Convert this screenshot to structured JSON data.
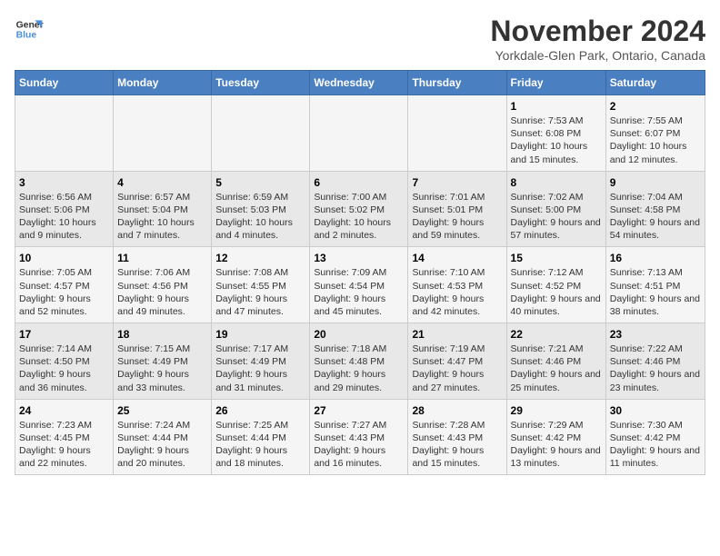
{
  "logo": {
    "line1": "General",
    "line2": "Blue"
  },
  "title": "November 2024",
  "location": "Yorkdale-Glen Park, Ontario, Canada",
  "headers": [
    "Sunday",
    "Monday",
    "Tuesday",
    "Wednesday",
    "Thursday",
    "Friday",
    "Saturday"
  ],
  "weeks": [
    [
      {
        "day": "",
        "info": ""
      },
      {
        "day": "",
        "info": ""
      },
      {
        "day": "",
        "info": ""
      },
      {
        "day": "",
        "info": ""
      },
      {
        "day": "",
        "info": ""
      },
      {
        "day": "1",
        "info": "Sunrise: 7:53 AM\nSunset: 6:08 PM\nDaylight: 10 hours and 15 minutes."
      },
      {
        "day": "2",
        "info": "Sunrise: 7:55 AM\nSunset: 6:07 PM\nDaylight: 10 hours and 12 minutes."
      }
    ],
    [
      {
        "day": "3",
        "info": "Sunrise: 6:56 AM\nSunset: 5:06 PM\nDaylight: 10 hours and 9 minutes."
      },
      {
        "day": "4",
        "info": "Sunrise: 6:57 AM\nSunset: 5:04 PM\nDaylight: 10 hours and 7 minutes."
      },
      {
        "day": "5",
        "info": "Sunrise: 6:59 AM\nSunset: 5:03 PM\nDaylight: 10 hours and 4 minutes."
      },
      {
        "day": "6",
        "info": "Sunrise: 7:00 AM\nSunset: 5:02 PM\nDaylight: 10 hours and 2 minutes."
      },
      {
        "day": "7",
        "info": "Sunrise: 7:01 AM\nSunset: 5:01 PM\nDaylight: 9 hours and 59 minutes."
      },
      {
        "day": "8",
        "info": "Sunrise: 7:02 AM\nSunset: 5:00 PM\nDaylight: 9 hours and 57 minutes."
      },
      {
        "day": "9",
        "info": "Sunrise: 7:04 AM\nSunset: 4:58 PM\nDaylight: 9 hours and 54 minutes."
      }
    ],
    [
      {
        "day": "10",
        "info": "Sunrise: 7:05 AM\nSunset: 4:57 PM\nDaylight: 9 hours and 52 minutes."
      },
      {
        "day": "11",
        "info": "Sunrise: 7:06 AM\nSunset: 4:56 PM\nDaylight: 9 hours and 49 minutes."
      },
      {
        "day": "12",
        "info": "Sunrise: 7:08 AM\nSunset: 4:55 PM\nDaylight: 9 hours and 47 minutes."
      },
      {
        "day": "13",
        "info": "Sunrise: 7:09 AM\nSunset: 4:54 PM\nDaylight: 9 hours and 45 minutes."
      },
      {
        "day": "14",
        "info": "Sunrise: 7:10 AM\nSunset: 4:53 PM\nDaylight: 9 hours and 42 minutes."
      },
      {
        "day": "15",
        "info": "Sunrise: 7:12 AM\nSunset: 4:52 PM\nDaylight: 9 hours and 40 minutes."
      },
      {
        "day": "16",
        "info": "Sunrise: 7:13 AM\nSunset: 4:51 PM\nDaylight: 9 hours and 38 minutes."
      }
    ],
    [
      {
        "day": "17",
        "info": "Sunrise: 7:14 AM\nSunset: 4:50 PM\nDaylight: 9 hours and 36 minutes."
      },
      {
        "day": "18",
        "info": "Sunrise: 7:15 AM\nSunset: 4:49 PM\nDaylight: 9 hours and 33 minutes."
      },
      {
        "day": "19",
        "info": "Sunrise: 7:17 AM\nSunset: 4:49 PM\nDaylight: 9 hours and 31 minutes."
      },
      {
        "day": "20",
        "info": "Sunrise: 7:18 AM\nSunset: 4:48 PM\nDaylight: 9 hours and 29 minutes."
      },
      {
        "day": "21",
        "info": "Sunrise: 7:19 AM\nSunset: 4:47 PM\nDaylight: 9 hours and 27 minutes."
      },
      {
        "day": "22",
        "info": "Sunrise: 7:21 AM\nSunset: 4:46 PM\nDaylight: 9 hours and 25 minutes."
      },
      {
        "day": "23",
        "info": "Sunrise: 7:22 AM\nSunset: 4:46 PM\nDaylight: 9 hours and 23 minutes."
      }
    ],
    [
      {
        "day": "24",
        "info": "Sunrise: 7:23 AM\nSunset: 4:45 PM\nDaylight: 9 hours and 22 minutes."
      },
      {
        "day": "25",
        "info": "Sunrise: 7:24 AM\nSunset: 4:44 PM\nDaylight: 9 hours and 20 minutes."
      },
      {
        "day": "26",
        "info": "Sunrise: 7:25 AM\nSunset: 4:44 PM\nDaylight: 9 hours and 18 minutes."
      },
      {
        "day": "27",
        "info": "Sunrise: 7:27 AM\nSunset: 4:43 PM\nDaylight: 9 hours and 16 minutes."
      },
      {
        "day": "28",
        "info": "Sunrise: 7:28 AM\nSunset: 4:43 PM\nDaylight: 9 hours and 15 minutes."
      },
      {
        "day": "29",
        "info": "Sunrise: 7:29 AM\nSunset: 4:42 PM\nDaylight: 9 hours and 13 minutes."
      },
      {
        "day": "30",
        "info": "Sunrise: 7:30 AM\nSunset: 4:42 PM\nDaylight: 9 hours and 11 minutes."
      }
    ]
  ]
}
